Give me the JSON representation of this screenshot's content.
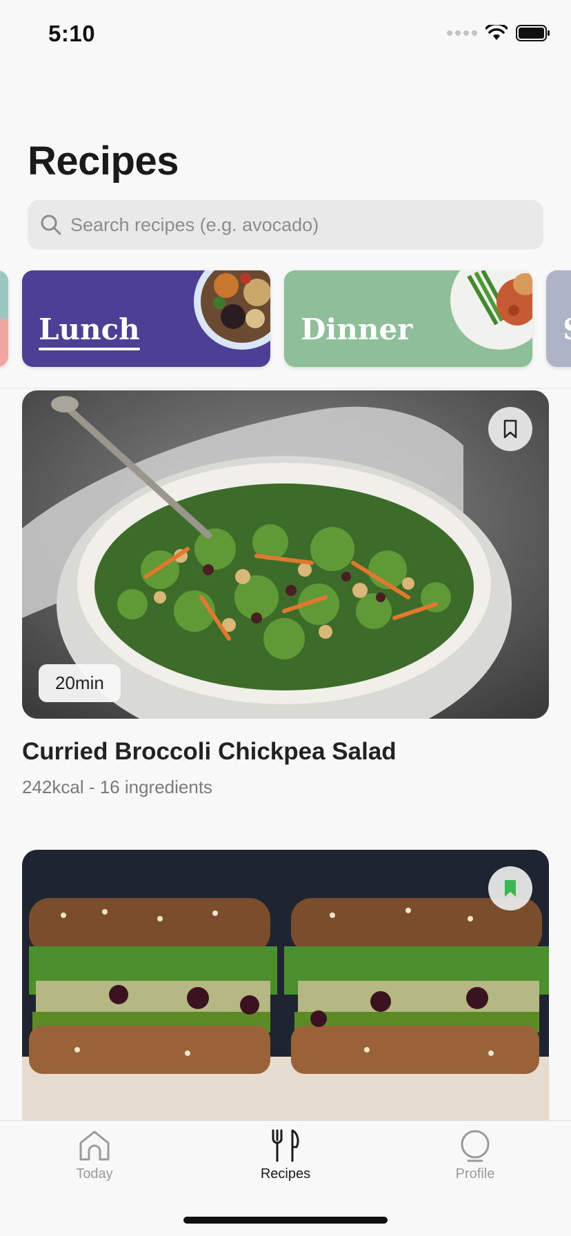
{
  "status_bar": {
    "time": "5:10"
  },
  "header": {
    "title": "Recipes"
  },
  "search": {
    "placeholder": "Search recipes (e.g. avocado)"
  },
  "categories": [
    {
      "label": "Lunch",
      "color": "#4e3f96",
      "active": true
    },
    {
      "label": "Dinner",
      "color": "#8fbf98",
      "active": false
    },
    {
      "label": "S",
      "color": "#aeb3c8",
      "active": false
    }
  ],
  "recipes": [
    {
      "title": "Curried Broccoli Chickpea Salad",
      "meta": "242kcal - 16 ingredients",
      "time": "20min",
      "bookmarked": false
    },
    {
      "title": "",
      "meta": "",
      "time": "",
      "bookmarked": true
    }
  ],
  "tabbar": {
    "items": [
      {
        "label": "Today",
        "icon": "home-icon",
        "active": false
      },
      {
        "label": "Recipes",
        "icon": "fork-knife-icon",
        "active": true
      },
      {
        "label": "Profile",
        "icon": "profile-icon",
        "active": false
      }
    ]
  },
  "colors": {
    "accent_green": "#3cb650",
    "lunch": "#4e3f96",
    "dinner": "#8fbf98",
    "tab_active": "#1a1a1a",
    "tab_inactive": "#9a9a9a"
  }
}
